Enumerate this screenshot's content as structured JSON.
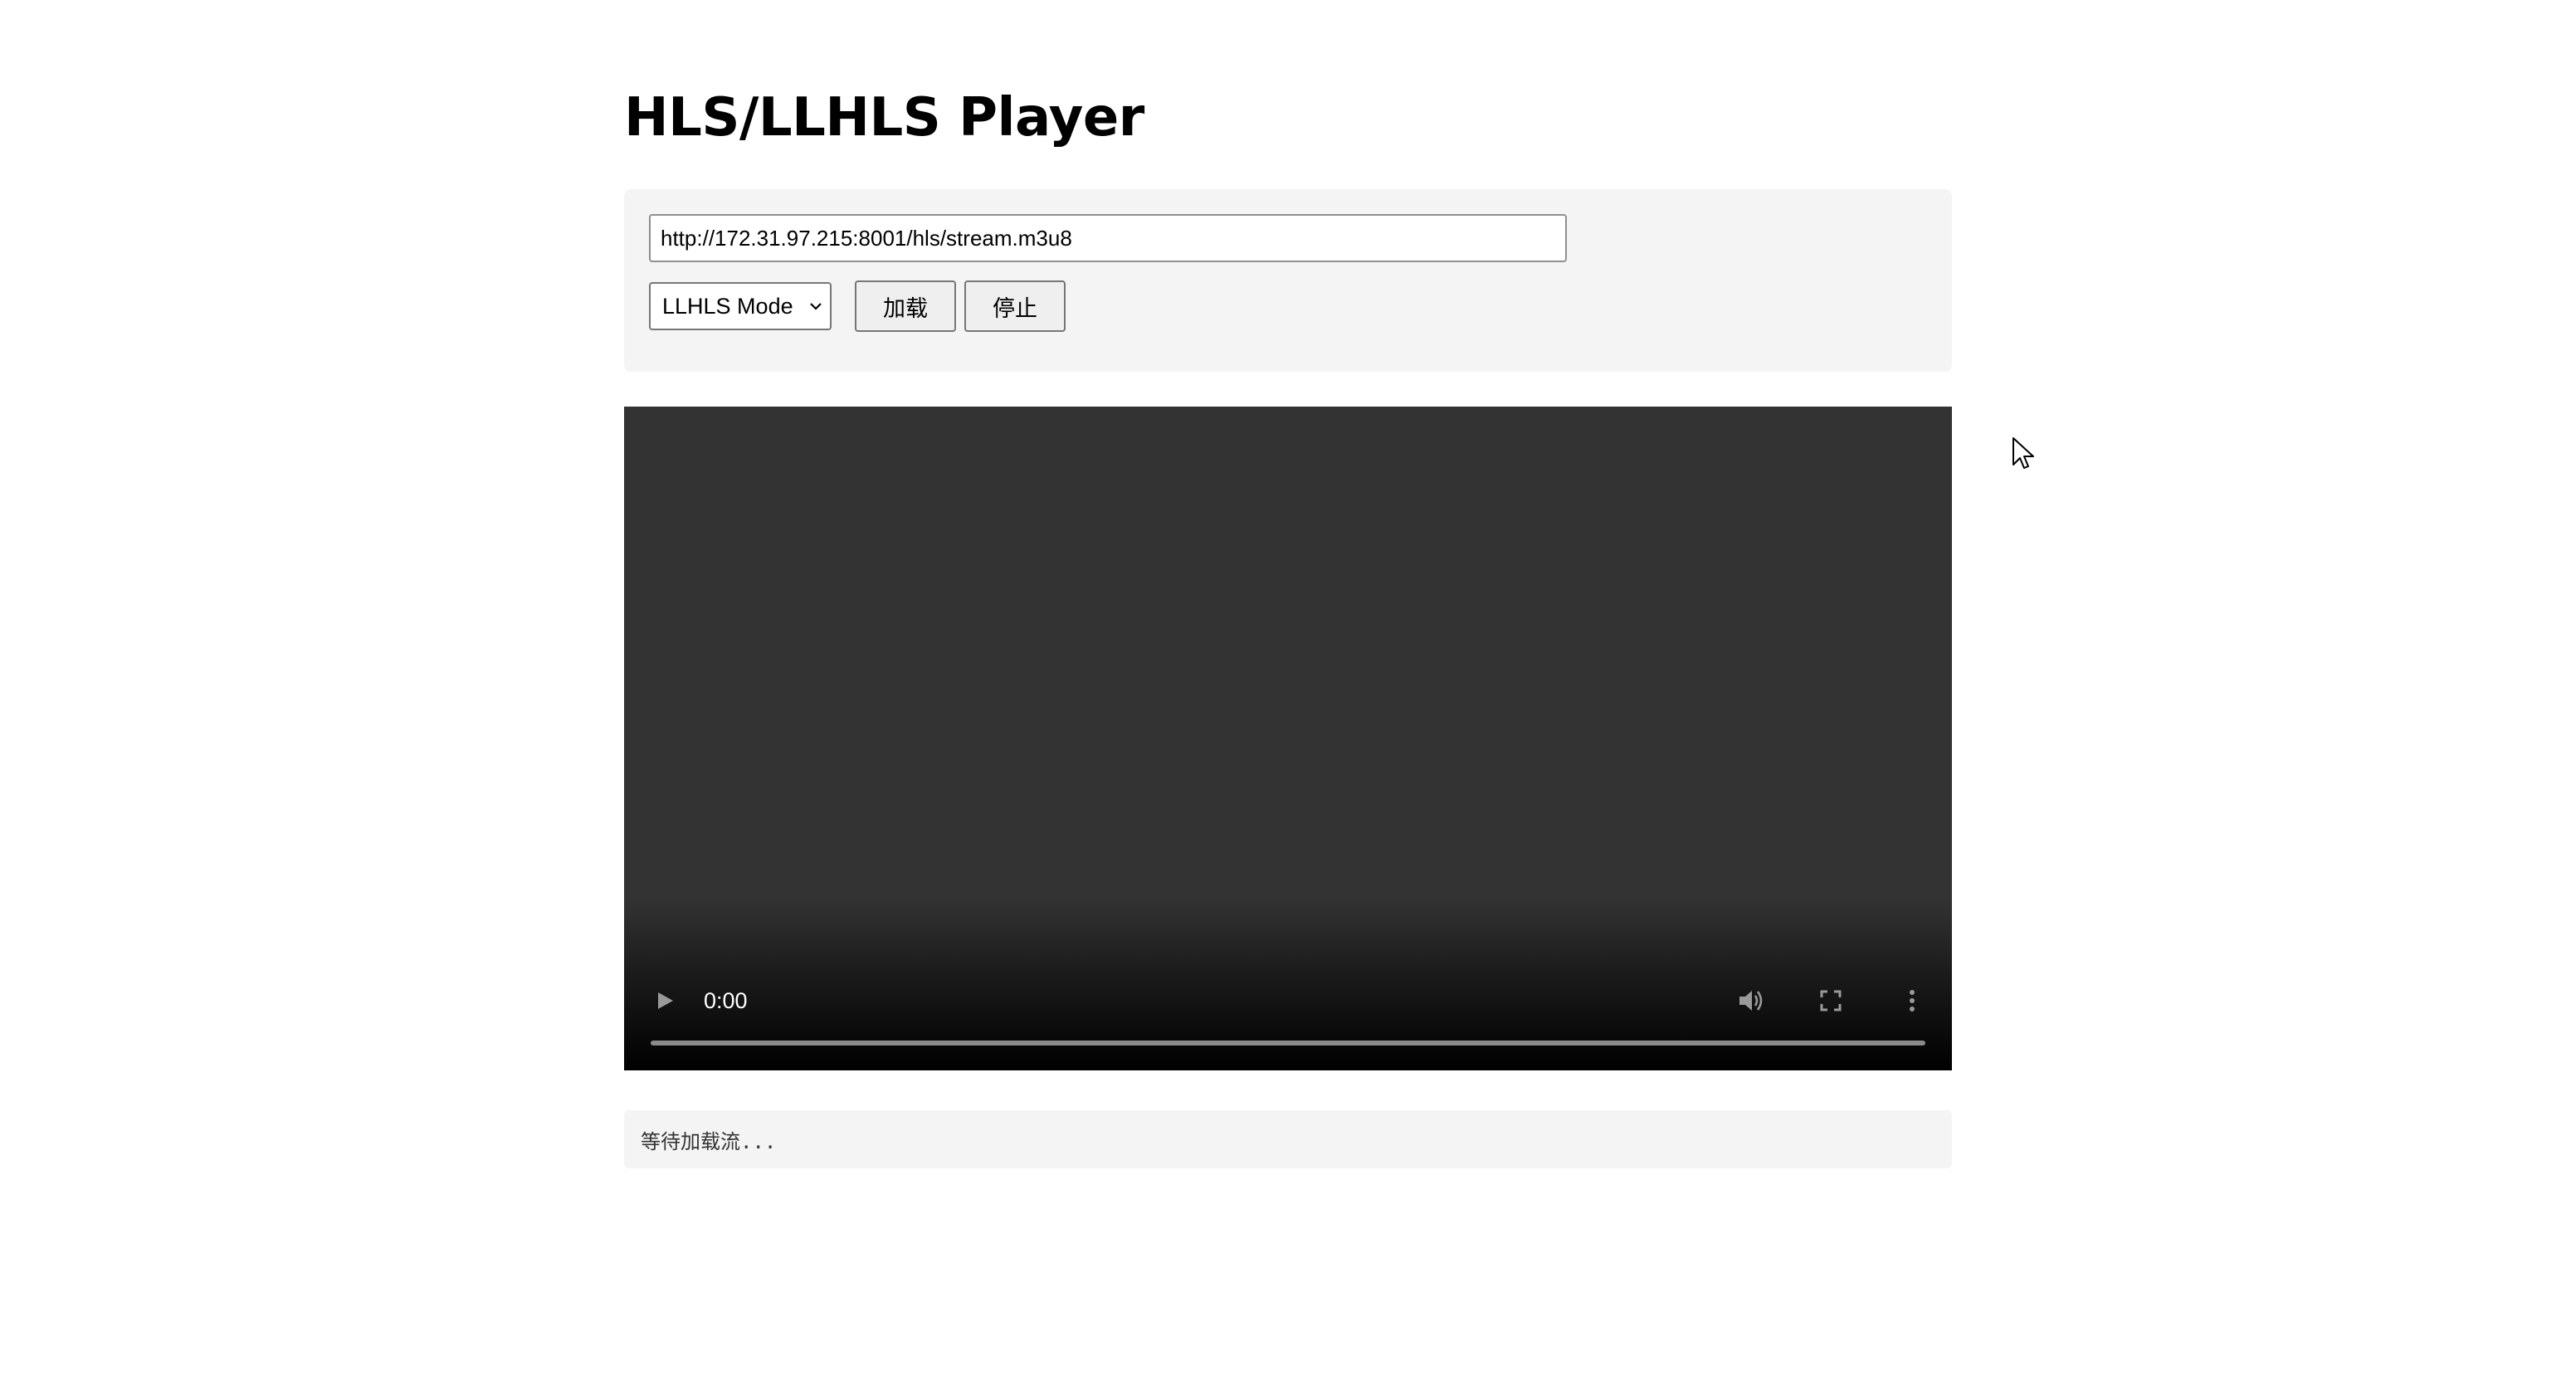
{
  "header": {
    "title": "HLS/LLHLS Player"
  },
  "controls": {
    "url_value": "http://172.31.97.215:8001/hls/stream.m3u8",
    "mode_selected": "LLHLS Mode",
    "load_label": "加载",
    "stop_label": "停止"
  },
  "video": {
    "time": "0:00",
    "icons": {
      "play": "play-icon",
      "volume": "volume-icon",
      "fullscreen": "fullscreen-icon",
      "more": "more-vert-icon"
    },
    "progress": 0
  },
  "status": {
    "text": "等待加载流..."
  },
  "colors": {
    "panel_bg": "#f4f4f4",
    "video_bg": "#333333"
  }
}
